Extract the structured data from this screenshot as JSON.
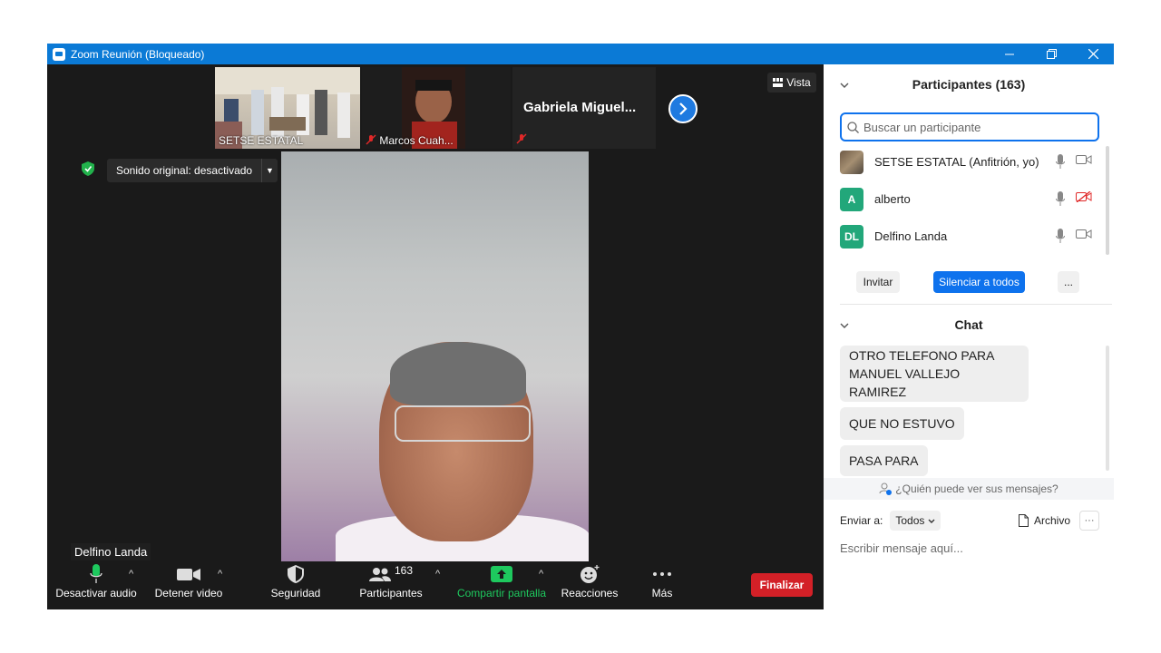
{
  "window": {
    "title": "Zoom Reunión (Bloqueado)",
    "minimize_icon": "minimize-icon",
    "restore_icon": "restore-icon",
    "close_icon": "close-icon"
  },
  "gallery": {
    "thumbnails": [
      {
        "name": "SETSE ESTATAL"
      },
      {
        "name": "Marcos Cuah..."
      },
      {
        "name": "Gabriela  Miguel..."
      }
    ],
    "view_label": "Vista"
  },
  "audio": {
    "original_sound": "Sonido original: desactivado"
  },
  "speaker": {
    "name": "Delfino Landa"
  },
  "toolbar": {
    "mute": "Desactivar audio",
    "video": "Detener video",
    "security": "Seguridad",
    "participants": "Participantes",
    "participants_count": "163",
    "share": "Compartir pantalla",
    "reactions": "Reacciones",
    "more": "Más",
    "end": "Finalizar",
    "colors": {
      "share": "#1ec95e",
      "end": "#d32027",
      "accent": "#0e72ed"
    }
  },
  "participants_panel": {
    "title": "Participantes (163)",
    "search_placeholder": "Buscar un participante",
    "list": [
      {
        "name": "SETSE ESTATAL (Anfitrión, yo)",
        "avatar": "",
        "muted_video": false
      },
      {
        "name": "alberto",
        "avatar": "A",
        "muted_video": true
      },
      {
        "name": "Delfino Landa",
        "avatar": "DL",
        "muted_video": false
      }
    ],
    "invite": "Invitar",
    "mute_all": "Silenciar a todos",
    "more": "..."
  },
  "chat_panel": {
    "title": "Chat",
    "messages": [
      "OTRO TELEFONO PARA MANUEL VALLEJO RAMIREZ",
      "QUE NO ESTUVO",
      "PASA PARA"
    ],
    "who_can_see": "¿Quién puede ver sus mensajes?",
    "send_to_label": "Enviar a:",
    "send_to_value": "Todos",
    "file": "Archivo",
    "input_placeholder": "Escribir mensaje aquí..."
  }
}
